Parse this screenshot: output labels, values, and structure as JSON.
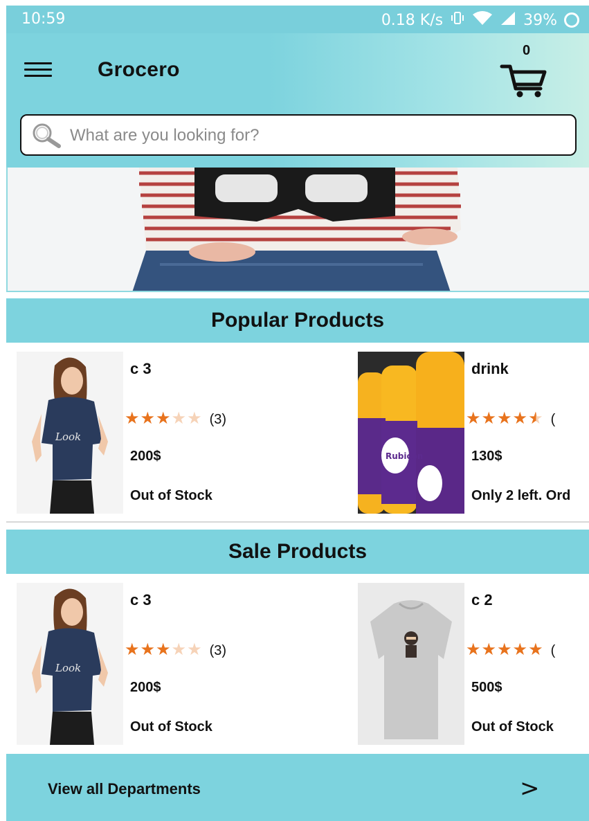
{
  "status_bar": {
    "time": "10:59",
    "speed": "0.18 K/s",
    "battery": "39%"
  },
  "app_bar": {
    "title": "Grocero",
    "cart_count": "0"
  },
  "search": {
    "placeholder": "What are you looking for?"
  },
  "sections": {
    "popular": {
      "title": "Popular Products",
      "items": [
        {
          "name": "c 3",
          "rating": 3,
          "max": 5,
          "reviews": "(3)",
          "price": "200$",
          "stock": "Out of Stock",
          "image": "woman-blue-tshirt"
        },
        {
          "name": "drink",
          "rating": 4.5,
          "max": 5,
          "reviews": "(",
          "price": "130$",
          "stock": "Only 2 left. Ord",
          "image": "juice-bottles"
        }
      ]
    },
    "sale": {
      "title": "Sale Products",
      "items": [
        {
          "name": "c 3",
          "rating": 3,
          "max": 5,
          "reviews": "(3)",
          "price": "200$",
          "stock": "Out of Stock",
          "image": "woman-blue-tshirt"
        },
        {
          "name": "c 2",
          "rating": 5,
          "max": 5,
          "reviews": "(",
          "price": "500$",
          "stock": "Out of Stock",
          "image": "grey-tshirt"
        }
      ]
    }
  },
  "footer": {
    "label": "View all Departments",
    "arrow": ">"
  },
  "colors": {
    "accent": "#7dd3de",
    "star_on": "#e8731d",
    "star_off": "#f6d3b8"
  }
}
